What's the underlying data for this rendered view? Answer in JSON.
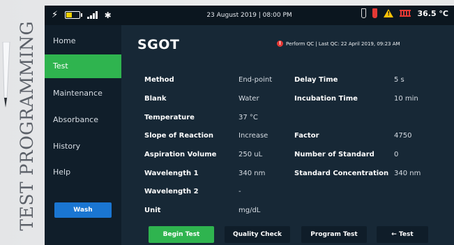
{
  "caption": "TEST PROGRAMMING",
  "status_bar": {
    "date_time": "23 August 2019 | 08:00 PM",
    "temperature": "36.5 °C",
    "left_icons": [
      "plug-icon",
      "battery-icon",
      "signal-icon",
      "bluetooth-icon"
    ],
    "right_icons": [
      "reagent-tube-icon",
      "red-tube-icon",
      "warning-icon",
      "heater-icon"
    ],
    "colors": {
      "battery_fill": "#f4d000",
      "warning": "#ffc107",
      "alert": "#e53935"
    }
  },
  "nav": {
    "items": [
      "Home",
      "Test",
      "Maintenance",
      "Absorbance",
      "History",
      "Help"
    ],
    "active": "Test",
    "wash_label": "Wash",
    "colors": {
      "active": "#2fb44f",
      "wash": "#1a76d2"
    }
  },
  "test": {
    "name": "SGOT",
    "qc_notice": "Perform QC | Last QC: 22 April 2019, 09:23 AM",
    "qc_icon": "alert-dot-icon",
    "left_params": [
      {
        "label": "Method",
        "value": "End-point"
      },
      {
        "label": "Blank",
        "value": "Water"
      },
      {
        "label": "Temperature",
        "value": "37 °C"
      },
      {
        "label": "Slope of Reaction",
        "value": "Increase"
      },
      {
        "label": "Aspiration Volume",
        "value": "250 uL"
      },
      {
        "label": "Wavelength 1",
        "value": "340 nm"
      },
      {
        "label": "Wavelength 2",
        "value": "-"
      },
      {
        "label": "Unit",
        "value": "mg/dL"
      }
    ],
    "right_params": [
      {
        "label": "Delay Time",
        "value": "5 s"
      },
      {
        "label": "Incubation Time",
        "value": "10 min"
      },
      {
        "label": "",
        "value": ""
      },
      {
        "label": "Factor",
        "value": "4750"
      },
      {
        "label": "Number of Standard",
        "value": "0"
      },
      {
        "label": "Standard Concentration",
        "value": "340 nm"
      }
    ]
  },
  "actions": {
    "begin": "Begin Test",
    "qc": "Quality Check",
    "program": "Program Test",
    "back": "← Test"
  }
}
